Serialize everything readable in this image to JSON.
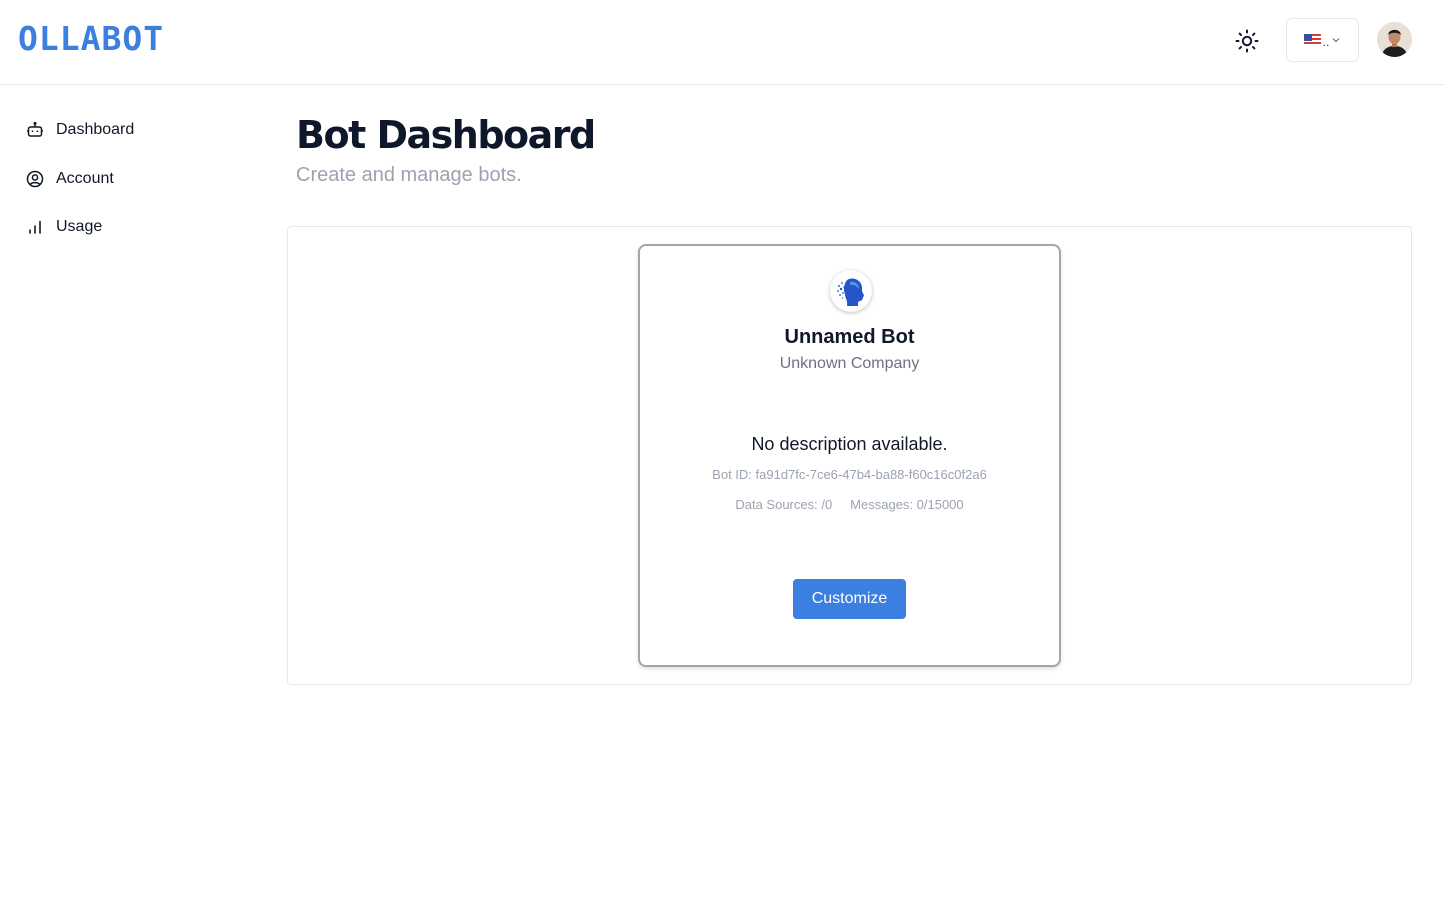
{
  "header": {
    "logo": "OLLABOT",
    "theme_icon": "sun-icon",
    "language": {
      "flag": "us-flag",
      "label": ".."
    },
    "user_avatar": "user-avatar"
  },
  "sidebar": {
    "items": [
      {
        "label": "Dashboard",
        "icon": "bot-icon"
      },
      {
        "label": "Account",
        "icon": "user-circle-icon"
      },
      {
        "label": "Usage",
        "icon": "bar-chart-icon"
      }
    ]
  },
  "main": {
    "title": "Bot Dashboard",
    "subtitle": "Create and manage bots."
  },
  "bot_card": {
    "name": "Unnamed Bot",
    "company": "Unknown Company",
    "description": "No description available.",
    "bot_id": "Bot ID: fa91d7fc-7ce6-47b4-ba88-f60c16c0f2a6",
    "data_sources": "Data Sources: /0",
    "messages": "Messages: 0/15000",
    "button_label": "Customize"
  },
  "colors": {
    "brand": "#3b7fe0",
    "muted_text": "#9ca3af",
    "border": "#e5e7eb"
  }
}
